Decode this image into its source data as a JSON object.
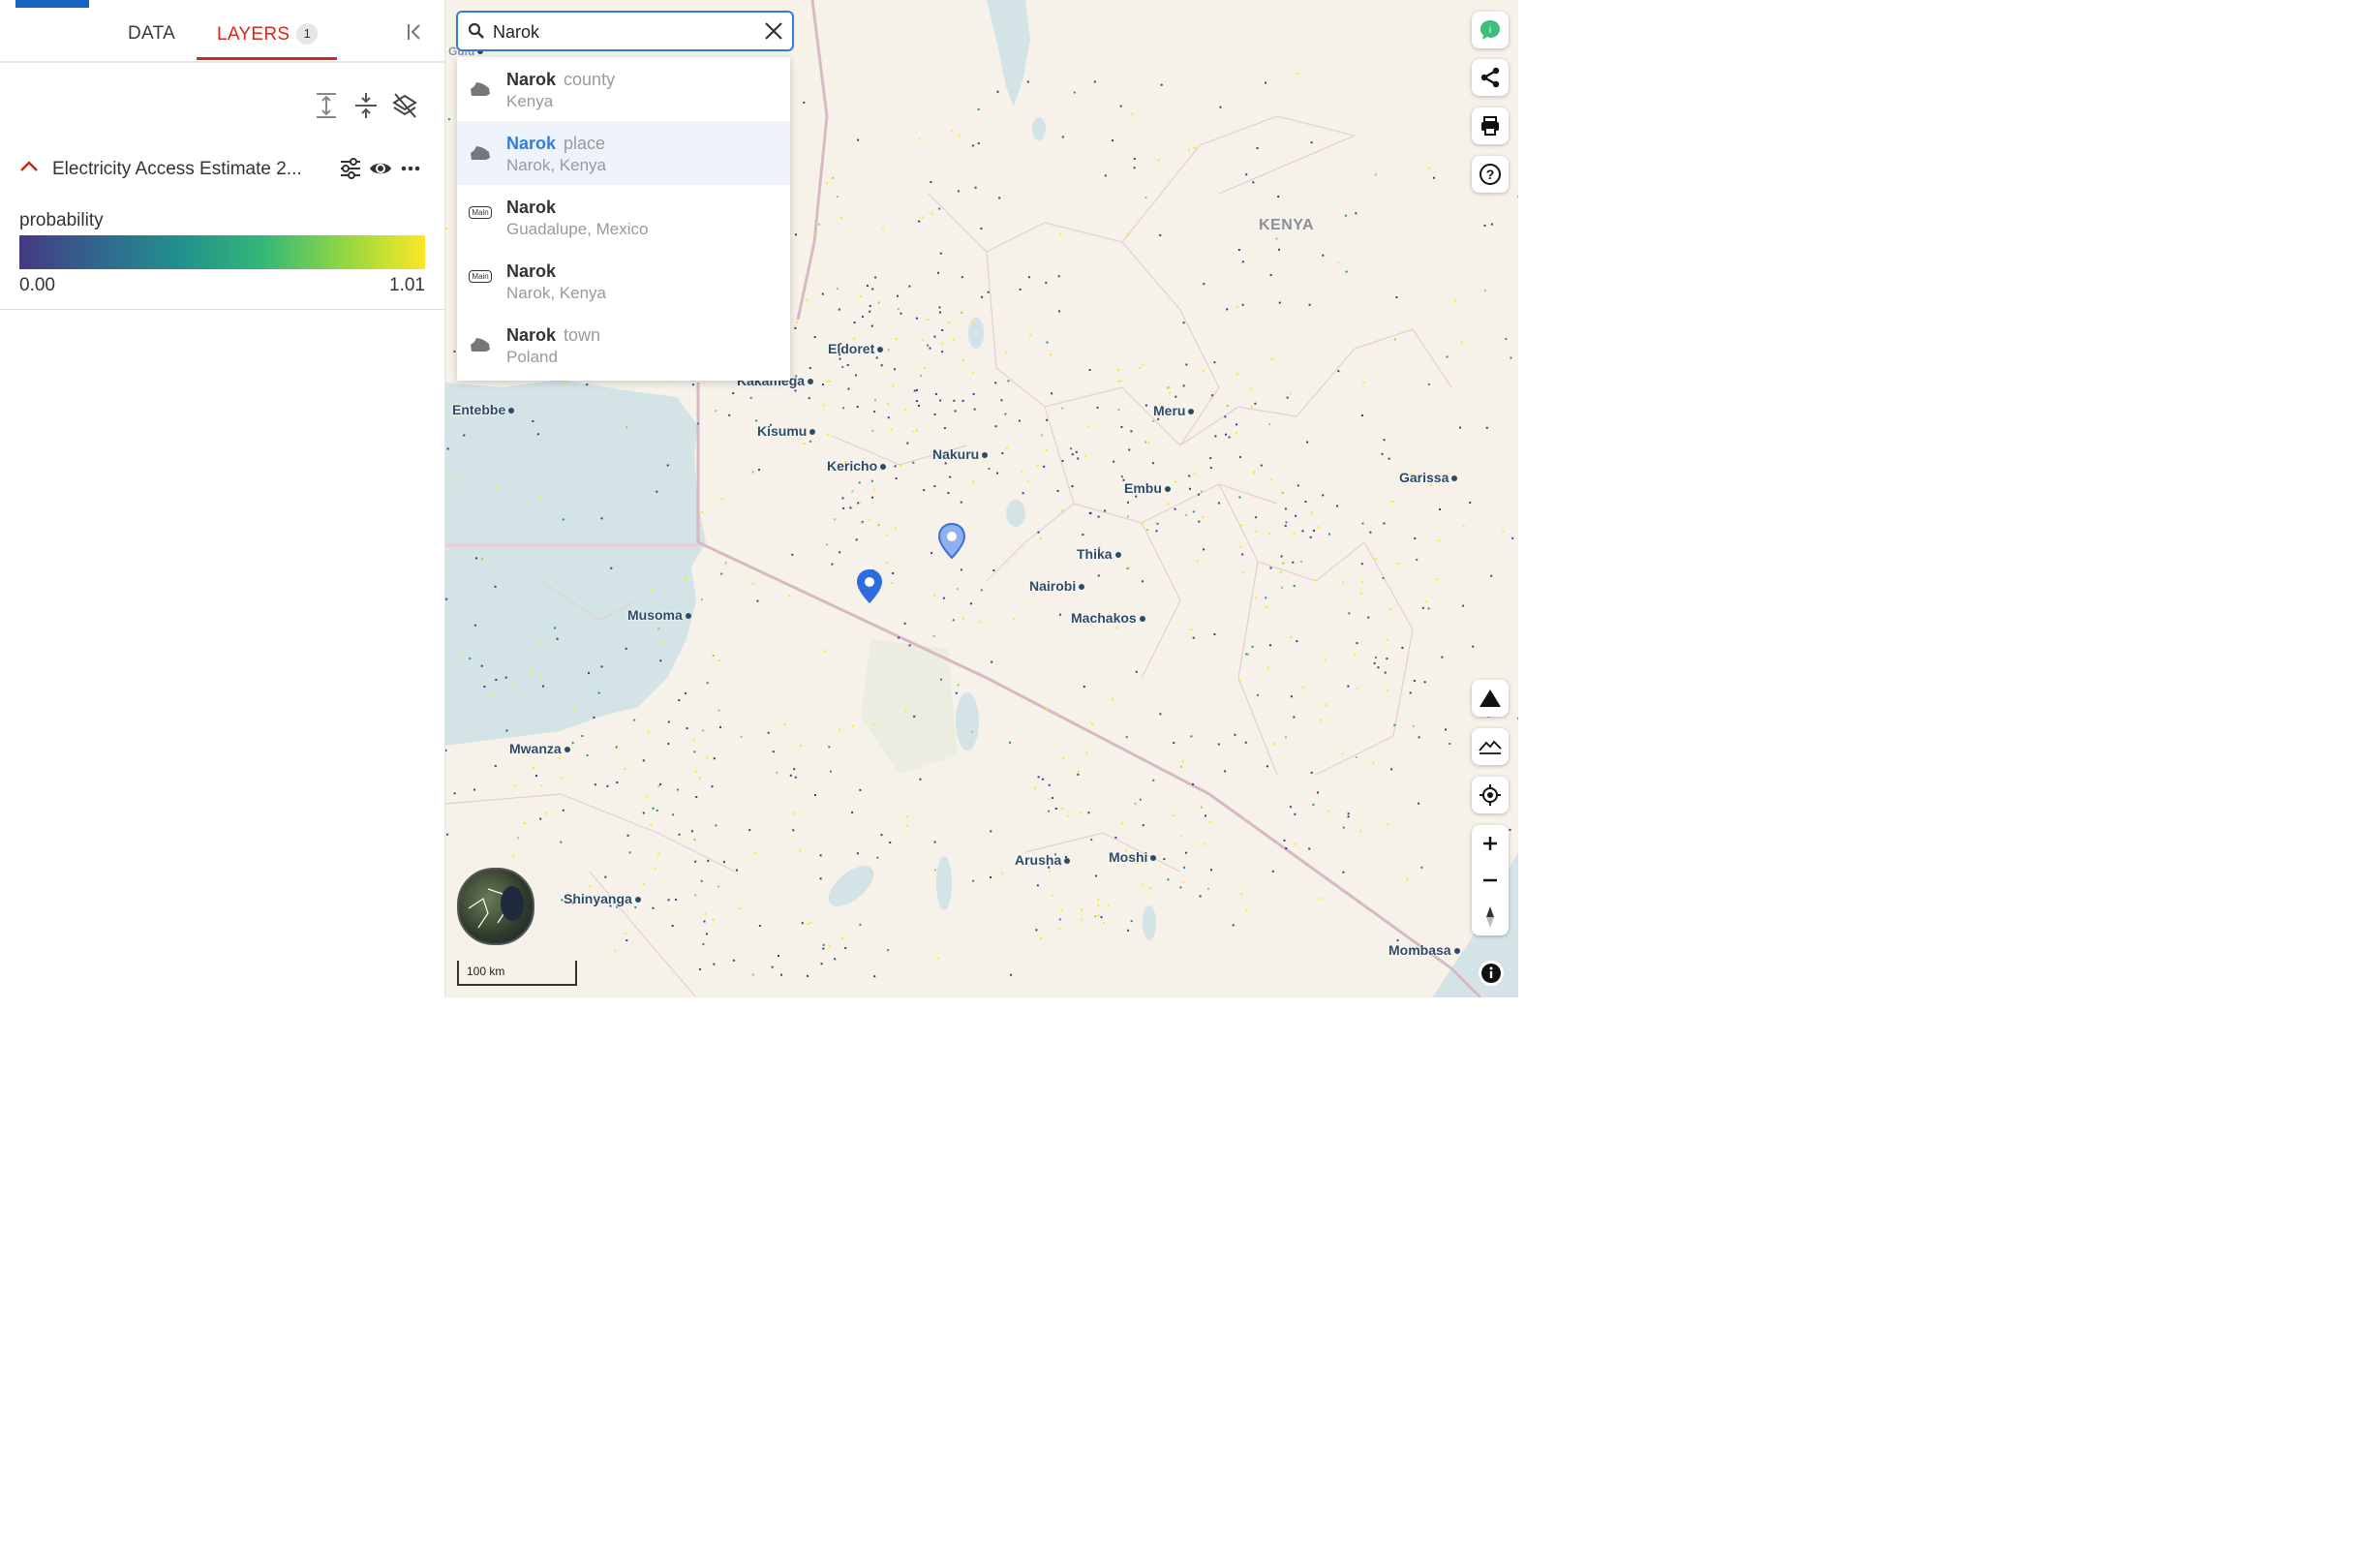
{
  "sidebar": {
    "tabs": [
      {
        "label": "DATA"
      },
      {
        "label": "LAYERS",
        "count": "1"
      }
    ],
    "layer": {
      "title": "Electricity Access Estimate 2...",
      "legend_label": "probability",
      "legend_min": "0.00",
      "legend_max": "1.01",
      "colors": [
        "#443983",
        "#31688e",
        "#21918c",
        "#35b779",
        "#90d743",
        "#fde725"
      ]
    }
  },
  "search": {
    "value": "Narok",
    "results": [
      {
        "name": "Narok",
        "type": "county",
        "sub": "Kenya",
        "icon": "region-icon"
      },
      {
        "name": "Narok",
        "type": "place",
        "sub": "Narok, Kenya",
        "icon": "region-icon",
        "highlighted": true
      },
      {
        "name": "Narok",
        "type": "",
        "sub": "Guadalupe, Mexico",
        "icon": "main-road-icon",
        "badge": "Main"
      },
      {
        "name": "Narok",
        "type": "",
        "sub": "Narok, Kenya",
        "icon": "main-road-icon",
        "badge": "Main"
      },
      {
        "name": "Narok",
        "type": "town",
        "sub": "Poland",
        "icon": "region-icon"
      }
    ]
  },
  "map": {
    "country_label": "KENYA",
    "cities": [
      "Eldoret",
      "Kakamega",
      "Entebbe",
      "Kisumu",
      "Kericho",
      "Nakuru",
      "Meru",
      "Embu",
      "Garissa",
      "Thika",
      "Nairobi",
      "Machakos",
      "Musoma",
      "Mwanza",
      "Arusha",
      "Moshi",
      "Shinyanga",
      "Mombasa",
      "Gulu"
    ],
    "scale": "100 km",
    "water_color": "#d4e4e6",
    "land_color": "#f6f2ea"
  }
}
